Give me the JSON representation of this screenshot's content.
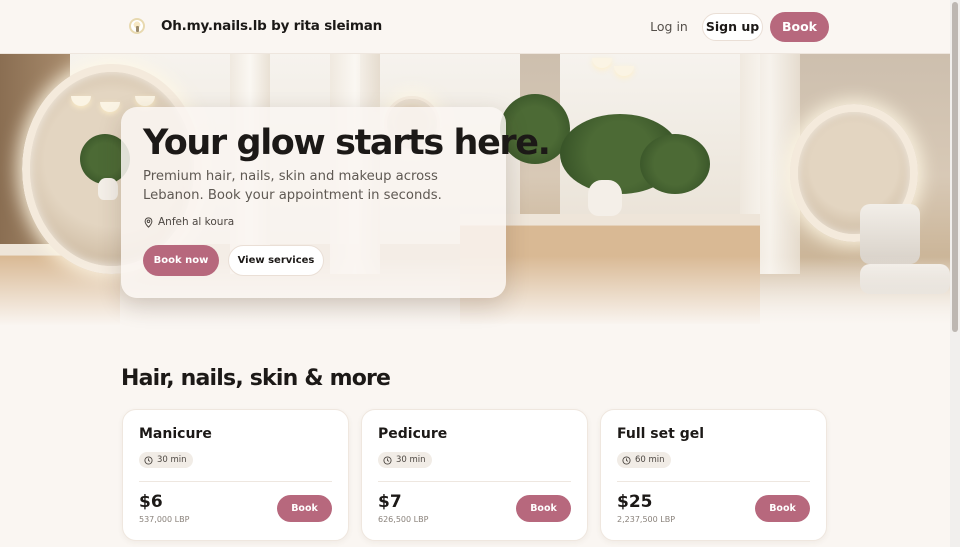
{
  "header": {
    "brand": "Oh.my.nails.lb by rita sleiman",
    "login_label": "Log in",
    "signup_label": "Sign up",
    "book_label": "Book"
  },
  "hero": {
    "title": "Your glow starts here.",
    "subtitle": "Premium hair, nails, skin and makeup across Lebanon. Book your appointment in seconds.",
    "location": "Anfeh al koura",
    "book_now_label": "Book now",
    "view_services_label": "View services"
  },
  "services": {
    "title": "Hair, nails, skin & more",
    "items": [
      {
        "name": "Manicure",
        "duration": "30 min",
        "price": "$6",
        "lbp": "537,000 LBP",
        "book_label": "Book"
      },
      {
        "name": "Pedicure",
        "duration": "30 min",
        "price": "$7",
        "lbp": "626,500 LBP",
        "book_label": "Book"
      },
      {
        "name": "Full set gel",
        "duration": "60 min",
        "price": "$25",
        "lbp": "2,237,500 LBP",
        "book_label": "Book"
      }
    ]
  },
  "colors": {
    "accent": "#b7687d",
    "background": "#faf6f2",
    "text": "#1c1917"
  },
  "icons": {
    "logo": "logo-icon",
    "location": "map-pin-icon",
    "duration": "clock-icon"
  }
}
